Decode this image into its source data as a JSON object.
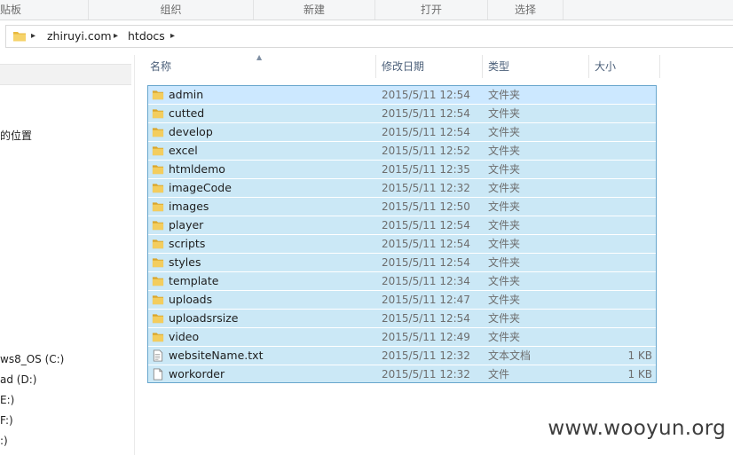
{
  "ribbon": {
    "groups": [
      "贴板",
      "组织",
      "新建",
      "打开",
      "选择"
    ]
  },
  "address": {
    "crumbs": [
      "zhiruyi.com",
      "htdocs"
    ]
  },
  "nav": {
    "items": [
      "的位置",
      "ws8_OS (C:)",
      "ad (D:)",
      "E:)",
      "F:)",
      ":)"
    ]
  },
  "columns": {
    "name": "名称",
    "date": "修改日期",
    "type": "类型",
    "size": "大小"
  },
  "files": [
    {
      "name": "admin",
      "date": "2015/5/11 12:54",
      "type": "文件夹",
      "size": "",
      "icon": "folder-icon"
    },
    {
      "name": "cutted",
      "date": "2015/5/11 12:54",
      "type": "文件夹",
      "size": "",
      "icon": "folder-icon"
    },
    {
      "name": "develop",
      "date": "2015/5/11 12:54",
      "type": "文件夹",
      "size": "",
      "icon": "folder-icon"
    },
    {
      "name": "excel",
      "date": "2015/5/11 12:52",
      "type": "文件夹",
      "size": "",
      "icon": "folder-icon"
    },
    {
      "name": "htmldemo",
      "date": "2015/5/11 12:35",
      "type": "文件夹",
      "size": "",
      "icon": "folder-icon"
    },
    {
      "name": "imageCode",
      "date": "2015/5/11 12:32",
      "type": "文件夹",
      "size": "",
      "icon": "folder-icon"
    },
    {
      "name": "images",
      "date": "2015/5/11 12:50",
      "type": "文件夹",
      "size": "",
      "icon": "folder-icon"
    },
    {
      "name": "player",
      "date": "2015/5/11 12:54",
      "type": "文件夹",
      "size": "",
      "icon": "folder-icon"
    },
    {
      "name": "scripts",
      "date": "2015/5/11 12:54",
      "type": "文件夹",
      "size": "",
      "icon": "folder-icon"
    },
    {
      "name": "styles",
      "date": "2015/5/11 12:54",
      "type": "文件夹",
      "size": "",
      "icon": "folder-icon"
    },
    {
      "name": "template",
      "date": "2015/5/11 12:34",
      "type": "文件夹",
      "size": "",
      "icon": "folder-icon"
    },
    {
      "name": "uploads",
      "date": "2015/5/11 12:47",
      "type": "文件夹",
      "size": "",
      "icon": "folder-icon"
    },
    {
      "name": "uploadsrsize",
      "date": "2015/5/11 12:54",
      "type": "文件夹",
      "size": "",
      "icon": "folder-icon"
    },
    {
      "name": "video",
      "date": "2015/5/11 12:49",
      "type": "文件夹",
      "size": "",
      "icon": "folder-icon"
    },
    {
      "name": "websiteName.txt",
      "date": "2015/5/11 12:32",
      "type": "文本文档",
      "size": "1 KB",
      "icon": "text-file-icon"
    },
    {
      "name": "workorder",
      "date": "2015/5/11 12:32",
      "type": "文件",
      "size": "1 KB",
      "icon": "file-icon"
    }
  ],
  "watermark": "www.wooyun.org",
  "colors": {
    "selection": "#cbe8f6",
    "selection_border": "#68a6cd",
    "folder": "#e8b93c",
    "header_text": "#4c607a"
  }
}
